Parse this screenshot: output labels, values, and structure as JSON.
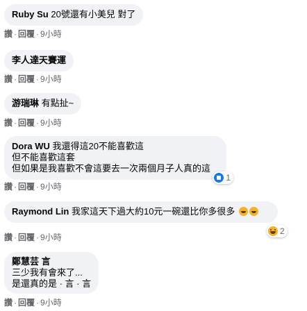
{
  "actions": {
    "like_label": "讚",
    "reply_label": "回覆",
    "sep": "·",
    "time": "9小時"
  },
  "comments": [
    {
      "name": "Ruby Su",
      "inline_text": "20號還有小美兒 對了",
      "lines": []
    },
    {
      "name": "李人達天賽運",
      "inline_text": "",
      "lines": []
    },
    {
      "name": "游瑞琳",
      "inline_text": "有點扯~",
      "lines": []
    },
    {
      "name": "Dora WU",
      "inline_text": "我還得這20不能喜歡這",
      "lines": [
        "但不能喜歡這套",
        "但如果是我喜歡不會這要去一次兩個月子人真的這"
      ],
      "reaction": {
        "type": "like",
        "count": "1"
      }
    },
    {
      "name": "Raymond Lin",
      "inline_text": "我家這天下過大約10元一碗還比你多很多",
      "lines": [],
      "reaction": {
        "type": "haha",
        "count": "2"
      }
    },
    {
      "name": "鄭慧芸 言",
      "inline_text": "",
      "lines": [
        "三少我有會來了...",
        "是還真的是 · 言 · 言"
      ]
    }
  ],
  "colors": {
    "bubble_bg": "#f0f2f5",
    "text": "#050505",
    "meta": "#65676b",
    "like_blue": "#1877f2",
    "haha_yellow": "#f7b125"
  }
}
